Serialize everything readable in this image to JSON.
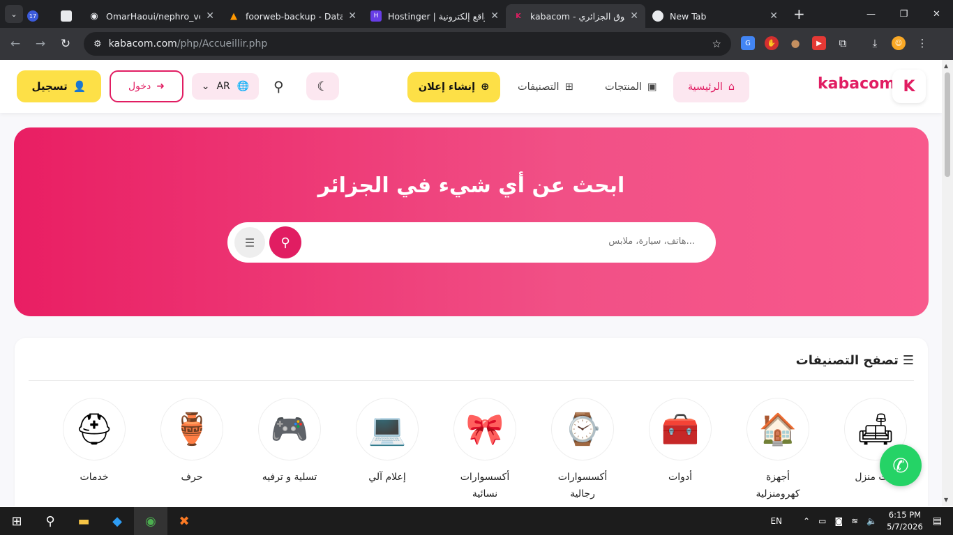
{
  "browser": {
    "tabs": [
      {
        "title": "OmarHaoui/nephro_vet",
        "favicon": "github-icon",
        "active": false
      },
      {
        "title": "foorweb-backup - Databa",
        "favicon": "firebase-icon",
        "active": false
      },
      {
        "title": "Hostinger | مواقع إلكترونية",
        "favicon": "hostinger-icon",
        "active": false
      },
      {
        "title": "kabacom - السوق الجزائري",
        "favicon": "kabacom-icon",
        "active": true
      },
      {
        "title": "New Tab",
        "favicon": "chrome-icon",
        "active": false
      }
    ],
    "badge_count": "17",
    "url_host": "kabacom.com",
    "url_path": "/php/Accueillir.php"
  },
  "header": {
    "brand": "kabacom",
    "logo_text": "K",
    "nav": {
      "home": "الرئيسية",
      "products": "المنتجات",
      "categories": "التصنيفات"
    },
    "post_ad": "إنشاء إعلان",
    "lang": "AR",
    "login": "دخول",
    "register": "تسجيل"
  },
  "hero": {
    "title": "ابحث عن أي شيء في الجزائر",
    "placeholder": "هاتف، سيارة، ملابس..."
  },
  "categories": {
    "title": "تصفح التصنيفات",
    "items": [
      {
        "label": "أثاث منزل",
        "icon": "furniture-icon"
      },
      {
        "label": "أجهزة كهرومنزلية",
        "icon": "appliances-icon"
      },
      {
        "label": "أدوات",
        "icon": "tools-icon"
      },
      {
        "label": "أكسسوارات رجالية",
        "icon": "mens-accessories-icon"
      },
      {
        "label": "أكسسوارات نسائية",
        "icon": "womens-accessories-icon"
      },
      {
        "label": "إعلام آلي",
        "icon": "laptop-icon"
      },
      {
        "label": "تسلية و ترفيه",
        "icon": "console-icon"
      },
      {
        "label": "حرف",
        "icon": "vase-icon"
      },
      {
        "label": "خدمات",
        "icon": "helmet-icon"
      }
    ]
  },
  "taskbar": {
    "lang": "EN",
    "time": "6:15 PM",
    "date": "5/7/2026"
  },
  "colors": {
    "brand": "#e11d62",
    "accent": "#fde047",
    "whatsapp": "#25d366"
  }
}
